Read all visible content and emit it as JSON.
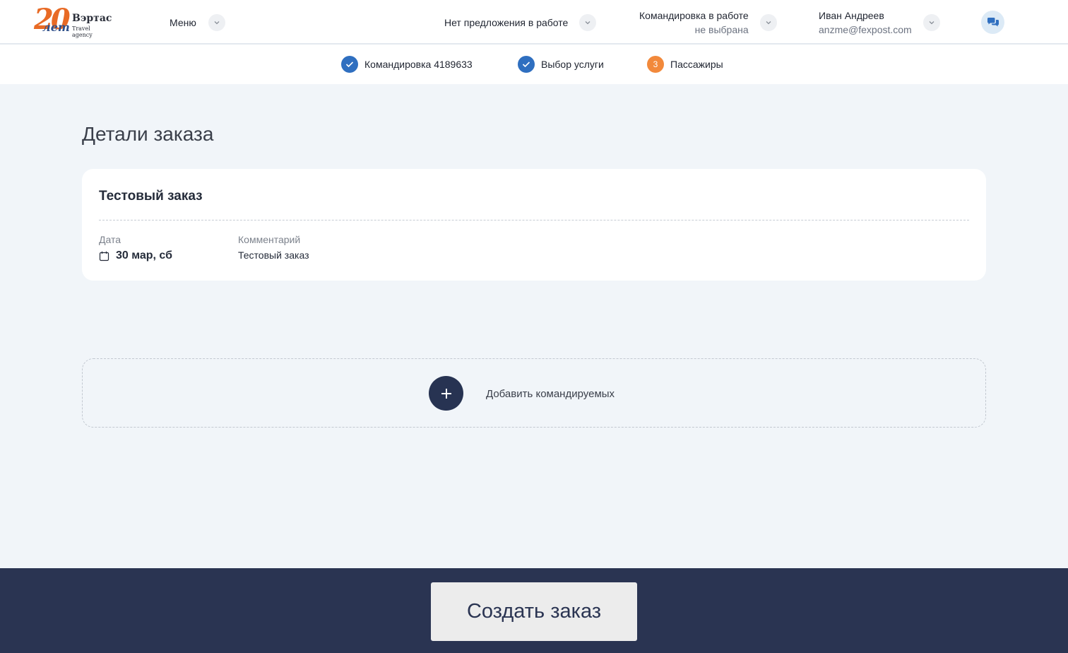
{
  "header": {
    "logo": {
      "number": "20",
      "years": "лет",
      "name": "Вэртас",
      "subtitle": "Travel agency"
    },
    "menu_label": "Меню",
    "offer_label": "Нет предложения в работе",
    "trip_label": "Командировка в работе",
    "trip_value": "не выбрана",
    "user_name": "Иван Андреев",
    "user_email": "anzme@fexpost.com"
  },
  "steps": [
    {
      "label": "Командировка 4189633",
      "state": "done"
    },
    {
      "label": "Выбор услуги",
      "state": "done"
    },
    {
      "label": "Пассажиры",
      "state": "current",
      "number": "3"
    }
  ],
  "main": {
    "title": "Детали заказа",
    "order": {
      "name": "Тестовый заказ",
      "date_label": "Дата",
      "date_value": "30 мар, сб",
      "comment_label": "Комментарий",
      "comment_value": "Тестовый заказ"
    },
    "add_travelers_label": "Добавить командируемых"
  },
  "footer": {
    "create_button": "Создать заказ"
  },
  "colors": {
    "accent_blue": "#2f6fc0",
    "accent_orange": "#f2893b",
    "navy": "#2a3452",
    "background": "#f1f5f9"
  }
}
